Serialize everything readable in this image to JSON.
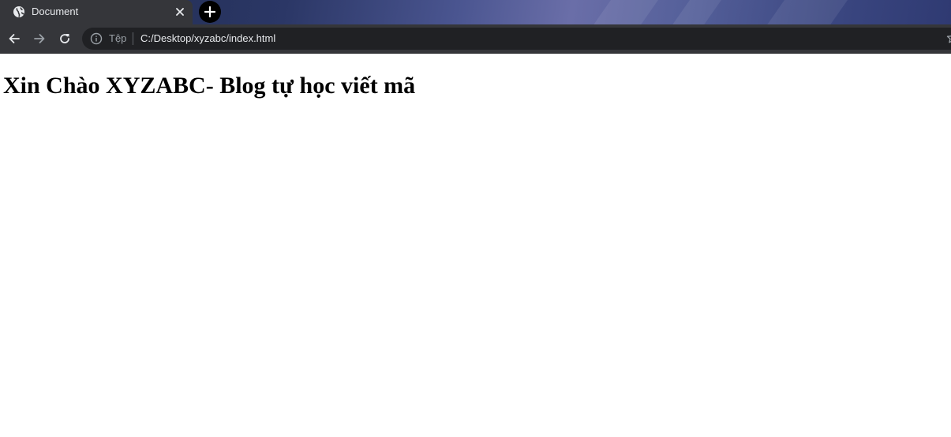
{
  "tab": {
    "title": "Document",
    "favicon": "globe-icon",
    "close": "close-icon"
  },
  "new_tab": {
    "icon": "plus-icon"
  },
  "toolbar": {
    "back": "arrow-left-icon",
    "forward": "arrow-right-icon",
    "reload": "reload-icon"
  },
  "address_bar": {
    "info_icon": "info-icon",
    "scheme_label": "Tệp",
    "url": "C:/Desktop/xyzabc/index.html",
    "bookmark_icon": "star-icon"
  },
  "page": {
    "heading": "Xin Chào XYZABC- Blog tự học viết mã"
  },
  "colors": {
    "tab_background": "#35363a",
    "toolbar_background": "#35363a",
    "omnibox_background": "#202124",
    "text_light": "#e8eaed",
    "text_dim": "#9aa0a6",
    "page_background": "#ffffff"
  }
}
